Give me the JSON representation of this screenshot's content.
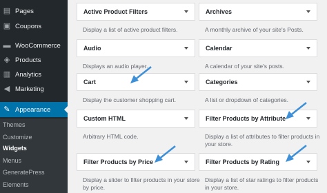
{
  "sidebar": {
    "items": [
      {
        "label": "Pages",
        "icon": "pages-icon"
      },
      {
        "label": "Coupons",
        "icon": "coupons-icon"
      },
      {
        "label": "WooCommerce",
        "icon": "woocommerce-icon"
      },
      {
        "label": "Products",
        "icon": "products-icon"
      },
      {
        "label": "Analytics",
        "icon": "analytics-icon"
      },
      {
        "label": "Marketing",
        "icon": "marketing-icon"
      },
      {
        "label": "Appearance",
        "icon": "appearance-icon"
      }
    ],
    "submenu": [
      "Themes",
      "Customize",
      "Widgets",
      "Menus",
      "GeneratePress",
      "Elements"
    ]
  },
  "widgets": {
    "left": [
      {
        "title": "Active Product Filters",
        "desc": "Display a list of active product filters."
      },
      {
        "title": "Audio",
        "desc": "Displays an audio player."
      },
      {
        "title": "Cart",
        "desc": "Display the customer shopping cart."
      },
      {
        "title": "Custom HTML",
        "desc": "Arbitrary HTML code."
      },
      {
        "title": "Filter Products by Price",
        "desc": "Display a slider to filter products in your store by price."
      }
    ],
    "right": [
      {
        "title": "Archives",
        "desc": "A monthly archive of your site's Posts."
      },
      {
        "title": "Calendar",
        "desc": "A calendar of your site's posts."
      },
      {
        "title": "Categories",
        "desc": "A list or dropdown of categories."
      },
      {
        "title": "Filter Products by Attribute",
        "desc": "Display a list of attributes to filter products in your store."
      },
      {
        "title": "Filter Products by Rating",
        "desc": "Display a list of star ratings to filter products in your store."
      }
    ]
  },
  "colors": {
    "sidebar": "#23282d",
    "active": "#0073aa",
    "pointer": "#3d8fd8"
  }
}
